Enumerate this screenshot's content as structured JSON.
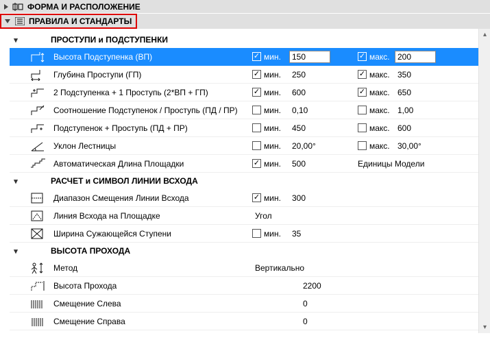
{
  "sections": {
    "shape": {
      "title": "ФОРМА И РАСПОЛОЖЕНИЕ"
    },
    "rules": {
      "title": "ПРАВИЛА И СТАНДАРТЫ"
    }
  },
  "labels": {
    "min": "мин.",
    "max": "макс."
  },
  "groups": {
    "steps": {
      "title": "ПРОСТУПИ и ПОДСТУПЕНКИ",
      "rows": [
        {
          "label": "Высота Подступенка (ВП)",
          "min_on": true,
          "min": "150",
          "max_on": true,
          "max": "200",
          "selected": true
        },
        {
          "label": "Глубина Проступи (ГП)",
          "min_on": true,
          "min": "250",
          "max_on": true,
          "max": "350"
        },
        {
          "label": "2 Подступенка + 1 Проступь (2*ВП + ГП)",
          "min_on": true,
          "min": "600",
          "max_on": true,
          "max": "650"
        },
        {
          "label": "Соотношение Подступенок / Проступь (ПД / ПР)",
          "min_on": false,
          "min": "0,10",
          "max_on": false,
          "max": "1,00"
        },
        {
          "label": "Подступенок + Проступь (ПД + ПР)",
          "min_on": false,
          "min": "450",
          "max_on": false,
          "max": "600"
        },
        {
          "label": "Уклон Лестницы",
          "min_on": false,
          "min": "20,00°",
          "max_on": false,
          "max": "30,00°"
        },
        {
          "label": "Автоматическая Длина Площадки",
          "min_on": true,
          "min": "500",
          "units": "Единицы Модели"
        }
      ]
    },
    "walking": {
      "title": "РАСЧЕТ и СИМВОЛ ЛИНИИ ВСХОДА",
      "rows": [
        {
          "label": "Диапазон Смещения Линии Всхода",
          "min_on": true,
          "min": "300"
        },
        {
          "label": "Линия Всхода на Площадке",
          "plain": "Угол"
        },
        {
          "label": "Ширина Сужающейся Ступени",
          "min_on": false,
          "min": "35"
        }
      ]
    },
    "headroom": {
      "title": "ВЫСОТА ПРОХОДА",
      "rows": [
        {
          "label": "Метод",
          "plain": "Вертикально"
        },
        {
          "label": "Высота Прохода",
          "center": "2200"
        },
        {
          "label": "Смещение Слева",
          "center": "0"
        },
        {
          "label": "Смещение Справа",
          "center": "0"
        }
      ]
    }
  }
}
